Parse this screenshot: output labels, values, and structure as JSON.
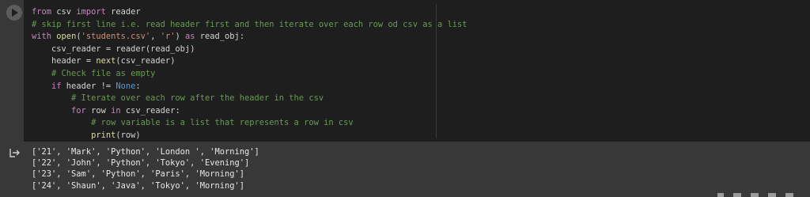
{
  "colors": {
    "background": "#383838",
    "editor_background": "#1e1e1e",
    "keyword": "#c586c0",
    "string": "#ce9178",
    "comment": "#6a9955",
    "builtin_function": "#dcdcaa",
    "constant": "#569cd6",
    "default_text": "#d4d4d4",
    "output_text": "#e8e8e8"
  },
  "cell": {
    "run_button_icon": "play-icon",
    "output_icon": "output-redirect-icon",
    "code_lines": [
      {
        "indent": "",
        "tokens": [
          {
            "type": "kw",
            "text": "from"
          },
          {
            "type": "id",
            "text": " csv "
          },
          {
            "type": "kw",
            "text": "import"
          },
          {
            "type": "id",
            "text": " reader"
          }
        ]
      },
      {
        "indent": "",
        "tokens": [
          {
            "type": "comment",
            "text": "# skip first line i.e. read header first and then iterate over each row od csv as a list"
          }
        ]
      },
      {
        "indent": "",
        "tokens": [
          {
            "type": "kw",
            "text": "with"
          },
          {
            "type": "id",
            "text": " "
          },
          {
            "type": "fn",
            "text": "open"
          },
          {
            "type": "op",
            "text": "("
          },
          {
            "type": "str",
            "text": "'students.csv'"
          },
          {
            "type": "op",
            "text": ", "
          },
          {
            "type": "str",
            "text": "'r'"
          },
          {
            "type": "op",
            "text": ") "
          },
          {
            "type": "kw",
            "text": "as"
          },
          {
            "type": "id",
            "text": " read_obj:"
          }
        ]
      },
      {
        "indent": "    ",
        "tokens": [
          {
            "type": "id",
            "text": "csv_reader = reader(read_obj)"
          }
        ]
      },
      {
        "indent": "    ",
        "tokens": [
          {
            "type": "id",
            "text": "header = "
          },
          {
            "type": "fn",
            "text": "next"
          },
          {
            "type": "id",
            "text": "(csv_reader)"
          }
        ]
      },
      {
        "indent": "    ",
        "tokens": [
          {
            "type": "comment",
            "text": "# Check file as empty"
          }
        ]
      },
      {
        "indent": "    ",
        "tokens": [
          {
            "type": "kw",
            "text": "if"
          },
          {
            "type": "id",
            "text": " header != "
          },
          {
            "type": "const",
            "text": "None"
          },
          {
            "type": "id",
            "text": ":"
          }
        ]
      },
      {
        "indent": "        ",
        "tokens": [
          {
            "type": "comment",
            "text": "# Iterate over each row after the header in the csv"
          }
        ]
      },
      {
        "indent": "        ",
        "tokens": [
          {
            "type": "kw",
            "text": "for"
          },
          {
            "type": "id",
            "text": " row "
          },
          {
            "type": "kw",
            "text": "in"
          },
          {
            "type": "id",
            "text": " csv_reader:"
          }
        ]
      },
      {
        "indent": "            ",
        "tokens": [
          {
            "type": "comment",
            "text": "# row variable is a list that represents a row in csv"
          }
        ]
      },
      {
        "indent": "            ",
        "tokens": [
          {
            "type": "fn",
            "text": "print"
          },
          {
            "type": "id",
            "text": "(row)"
          }
        ]
      }
    ],
    "output_lines": [
      "['21', 'Mark', 'Python', 'London ', 'Morning']",
      "['22', 'John', 'Python', 'Tokyo', 'Evening']",
      "['23', 'Sam', 'Python', 'Paris', 'Morning']",
      "['24', 'Shaun', 'Java', 'Tokyo', 'Morning']"
    ]
  }
}
